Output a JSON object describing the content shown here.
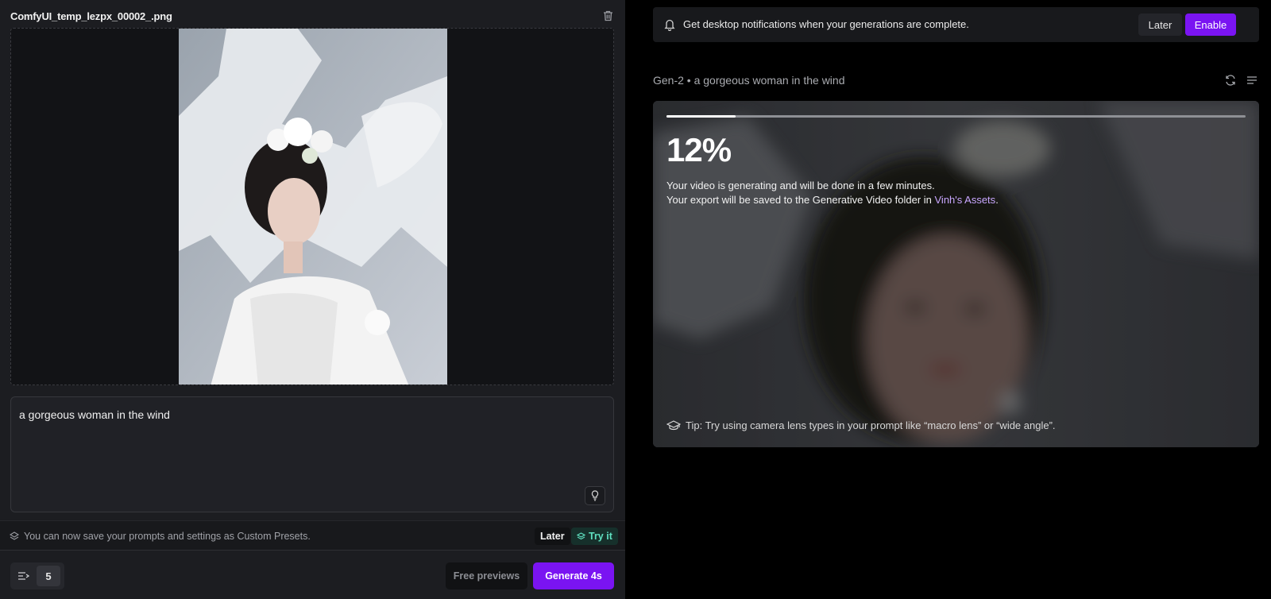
{
  "left_panel": {
    "file_name": "ComfyUI_temp_lezpx_00002_.png",
    "prompt": "a gorgeous woman in the wind",
    "preset_banner": {
      "text": "You can now save your prompts and settings as Custom Presets.",
      "later_label": "Later",
      "try_label": "Try it"
    },
    "bottom_bar": {
      "count": "5",
      "free_previews_label": "Free previews",
      "generate_label": "Generate 4s"
    }
  },
  "right_panel": {
    "notification": {
      "text": "Get desktop notifications when your generations are complete.",
      "later_label": "Later",
      "enable_label": "Enable"
    },
    "generation": {
      "title": "Gen-2 • a gorgeous woman in the wind",
      "progress": 0.12,
      "percent_label": "12%",
      "status_line1": "Your video is generating and will be done in a few minutes.",
      "status_line2_prefix": "Your export will be saved to the Generative Video folder in ",
      "status_link": "Vinh's Assets",
      "status_line2_suffix": ".",
      "tip": "Tip: Try using camera lens types in your prompt like “macro lens” or “wide angle”."
    }
  },
  "icons": {
    "trash": "trash-icon",
    "bulb": "lightbulb-icon",
    "layers": "layers-icon",
    "sliders": "sliders-icon",
    "bell": "bell-icon",
    "refresh": "refresh-icon",
    "list": "list-icon",
    "graduation_cap": "graduation-cap-icon"
  },
  "colors": {
    "accent_purple": "#7a14f2",
    "link_purple": "#c9a7ff",
    "try_green": "#5fe0c0"
  }
}
